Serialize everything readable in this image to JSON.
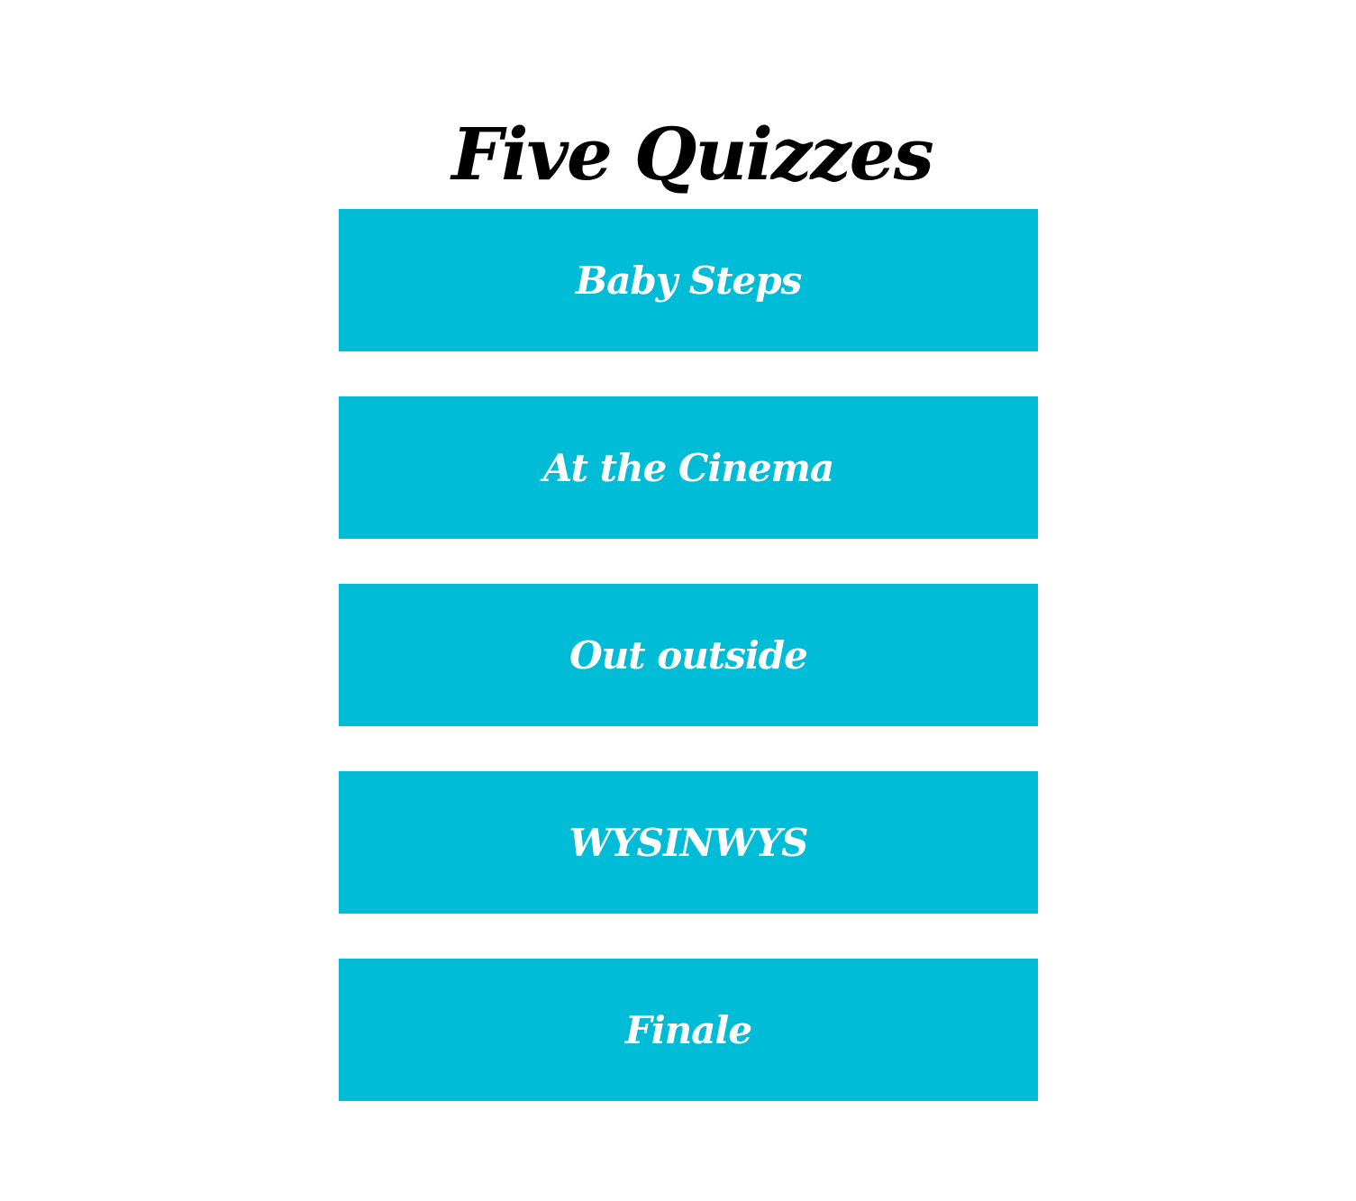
{
  "page": {
    "title": "Five Quizzes"
  },
  "colors": {
    "background": "#ffffff",
    "title": "#000000",
    "button_background": "#00bcd6",
    "button_text": "#ffffff"
  },
  "quizzes": [
    {
      "label": "Baby Steps"
    },
    {
      "label": "At the Cinema"
    },
    {
      "label": "Out outside"
    },
    {
      "label": "WYSINWYS"
    },
    {
      "label": "Finale"
    }
  ]
}
